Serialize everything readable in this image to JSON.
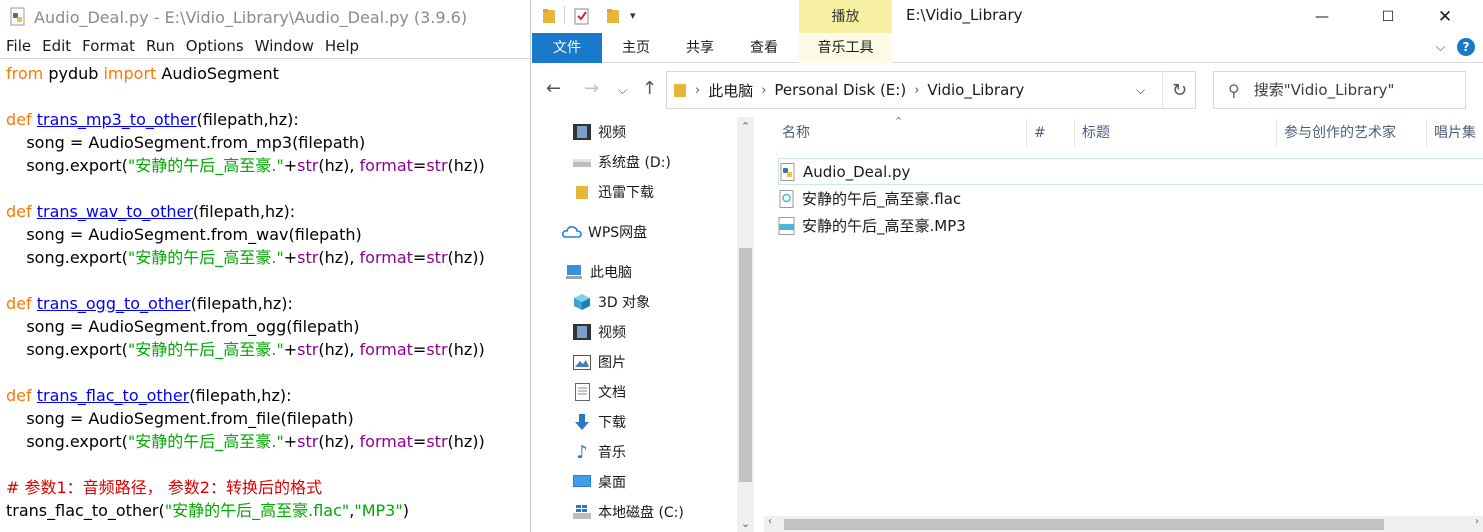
{
  "idle": {
    "title": "Audio_Deal.py - E:\\Vidio_Library\\Audio_Deal.py (3.9.6)",
    "menu": [
      "File",
      "Edit",
      "Format",
      "Run",
      "Options",
      "Window",
      "Help"
    ],
    "code_lines": [
      [
        [
          "kw",
          "from"
        ],
        [
          "plain",
          " pydub "
        ],
        [
          "kw",
          "import"
        ],
        [
          "plain",
          " AudioSegment"
        ]
      ],
      [],
      [
        [
          "kw",
          "def"
        ],
        [
          "plain",
          " "
        ],
        [
          "fn",
          "trans_mp3_to_other"
        ],
        [
          "plain",
          "(filepath,hz):"
        ]
      ],
      [
        [
          "plain",
          "    song = AudioSegment.from_mp3(filepath)"
        ]
      ],
      [
        [
          "plain",
          "    song.export("
        ],
        [
          "str",
          "\"安静的午后_高至豪.\""
        ],
        [
          "plain",
          "+"
        ],
        [
          "bi",
          "str"
        ],
        [
          "plain",
          "(hz), "
        ],
        [
          "bi",
          "format"
        ],
        [
          "plain",
          "="
        ],
        [
          "bi",
          "str"
        ],
        [
          "plain",
          "(hz))"
        ]
      ],
      [],
      [
        [
          "kw",
          "def"
        ],
        [
          "plain",
          " "
        ],
        [
          "fn",
          "trans_wav_to_other"
        ],
        [
          "plain",
          "(filepath,hz):"
        ]
      ],
      [
        [
          "plain",
          "    song = AudioSegment.from_wav(filepath)"
        ]
      ],
      [
        [
          "plain",
          "    song.export("
        ],
        [
          "str",
          "\"安静的午后_高至豪.\""
        ],
        [
          "plain",
          "+"
        ],
        [
          "bi",
          "str"
        ],
        [
          "plain",
          "(hz), "
        ],
        [
          "bi",
          "format"
        ],
        [
          "plain",
          "="
        ],
        [
          "bi",
          "str"
        ],
        [
          "plain",
          "(hz))"
        ]
      ],
      [],
      [
        [
          "kw",
          "def"
        ],
        [
          "plain",
          " "
        ],
        [
          "fn",
          "trans_ogg_to_other"
        ],
        [
          "plain",
          "(filepath,hz):"
        ]
      ],
      [
        [
          "plain",
          "    song = AudioSegment.from_ogg(filepath)"
        ]
      ],
      [
        [
          "plain",
          "    song.export("
        ],
        [
          "str",
          "\"安静的午后_高至豪.\""
        ],
        [
          "plain",
          "+"
        ],
        [
          "bi",
          "str"
        ],
        [
          "plain",
          "(hz), "
        ],
        [
          "bi",
          "format"
        ],
        [
          "plain",
          "="
        ],
        [
          "bi",
          "str"
        ],
        [
          "plain",
          "(hz))"
        ]
      ],
      [],
      [
        [
          "kw",
          "def"
        ],
        [
          "plain",
          " "
        ],
        [
          "fn",
          "trans_flac_to_other"
        ],
        [
          "plain",
          "(filepath,hz):"
        ]
      ],
      [
        [
          "plain",
          "    song = AudioSegment.from_file(filepath)"
        ]
      ],
      [
        [
          "plain",
          "    song.export("
        ],
        [
          "str",
          "\"安静的午后_高至豪.\""
        ],
        [
          "plain",
          "+"
        ],
        [
          "bi",
          "str"
        ],
        [
          "plain",
          "(hz), "
        ],
        [
          "bi",
          "format"
        ],
        [
          "plain",
          "="
        ],
        [
          "bi",
          "str"
        ],
        [
          "plain",
          "(hz))"
        ]
      ],
      [],
      [
        [
          "cm",
          "# 参数1：音频路径， 参数2：转换后的格式"
        ]
      ],
      [
        [
          "plain",
          "trans_flac_to_other("
        ],
        [
          "str",
          "\"安静的午后_高至豪.flac\""
        ],
        [
          "plain",
          ","
        ],
        [
          "str",
          "\"MP3\""
        ],
        [
          "plain",
          ")"
        ]
      ]
    ]
  },
  "explorer": {
    "context_tab_header": "播放",
    "window_title": "E:\\Vidio_Library",
    "tabs": {
      "file": "文件",
      "home": "主页",
      "share": "共享",
      "view": "查看",
      "context": "音乐工具"
    },
    "breadcrumb": [
      "此电脑",
      "Personal Disk (E:)",
      "Vidio_Library"
    ],
    "search_placeholder": "搜索\"Vidio_Library\"",
    "nav_items": {
      "videos1": "视频",
      "system_disk": "系统盘 (D:)",
      "xunlei": "迅雷下载",
      "wps": "WPS网盘",
      "this_pc": "此电脑",
      "objects3d": "3D 对象",
      "videos2": "视频",
      "pictures": "图片",
      "documents": "文档",
      "downloads": "下载",
      "music": "音乐",
      "desktop": "桌面",
      "local_disk": "本地磁盘 (C:)"
    },
    "columns": {
      "name": "名称",
      "number": "#",
      "title": "标题",
      "artist": "参与创作的艺术家",
      "album": "唱片集"
    },
    "files": [
      {
        "name": "Audio_Deal.py",
        "icon": "python-file-icon"
      },
      {
        "name": "安静的午后_高至豪.flac",
        "icon": "flac-file-icon"
      },
      {
        "name": "安静的午后_高至豪.MP3",
        "icon": "mp3-file-icon"
      }
    ],
    "colors": {
      "accent": "#1979ca",
      "context_tab": "#f7f0a2",
      "folder": "#e8b73a"
    }
  }
}
